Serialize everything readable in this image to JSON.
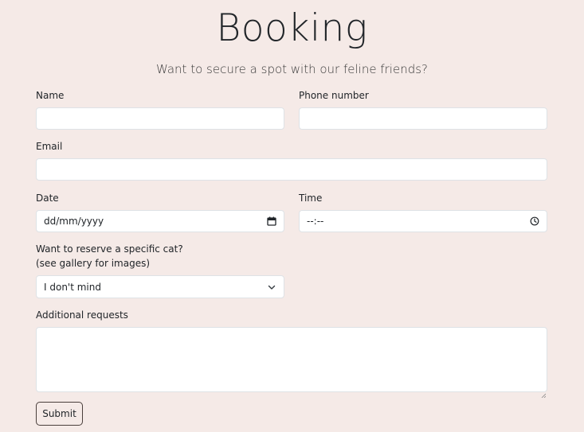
{
  "header": {
    "title": "Booking",
    "subtitle": "Want to secure a spot with our feline friends?"
  },
  "form": {
    "name": {
      "label": "Name",
      "value": ""
    },
    "phone": {
      "label": "Phone number",
      "value": ""
    },
    "email": {
      "label": "Email",
      "value": ""
    },
    "date": {
      "label": "Date",
      "placeholder": "dd/mm/yyyy",
      "icon": "calendar-icon"
    },
    "time": {
      "label": "Time",
      "placeholder": "--:--",
      "icon": "clock-icon"
    },
    "cat": {
      "label_line1": "Want to reserve a specific cat?",
      "label_line2": "(see gallery for images)",
      "selected": "I don't mind",
      "icon": "chevron-down-icon"
    },
    "requests": {
      "label": "Additional requests",
      "value": ""
    },
    "submit_label": "Submit"
  },
  "colors": {
    "background": "#f5eae7",
    "field_background": "#ffffff",
    "field_border": "#dee2e6",
    "button_border": "#4a3f3c"
  }
}
